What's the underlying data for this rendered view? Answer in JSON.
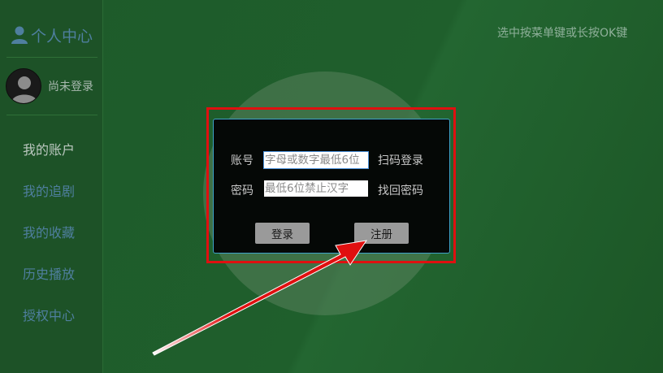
{
  "sidebar": {
    "title": "个人中心",
    "user_status": "尚未登录",
    "items": [
      {
        "label": "我的账户",
        "active": true
      },
      {
        "label": "我的追剧",
        "active": false
      },
      {
        "label": "我的收藏",
        "active": false
      },
      {
        "label": "历史播放",
        "active": false
      },
      {
        "label": "授权中心",
        "active": false
      }
    ]
  },
  "hint": "选中按菜单键或长按OK键",
  "dialog": {
    "account_label": "账号",
    "account_placeholder": "字母或数字最低6位",
    "scan_login": "扫码登录",
    "password_label": "密码",
    "password_placeholder": "最低6位禁止汉字",
    "forgot_password": "找回密码",
    "login_button": "登录",
    "register_button": "注册"
  },
  "colors": {
    "highlight": "#e01010",
    "dialog_border": "#3ea3c8",
    "arrow": "#e01010"
  }
}
